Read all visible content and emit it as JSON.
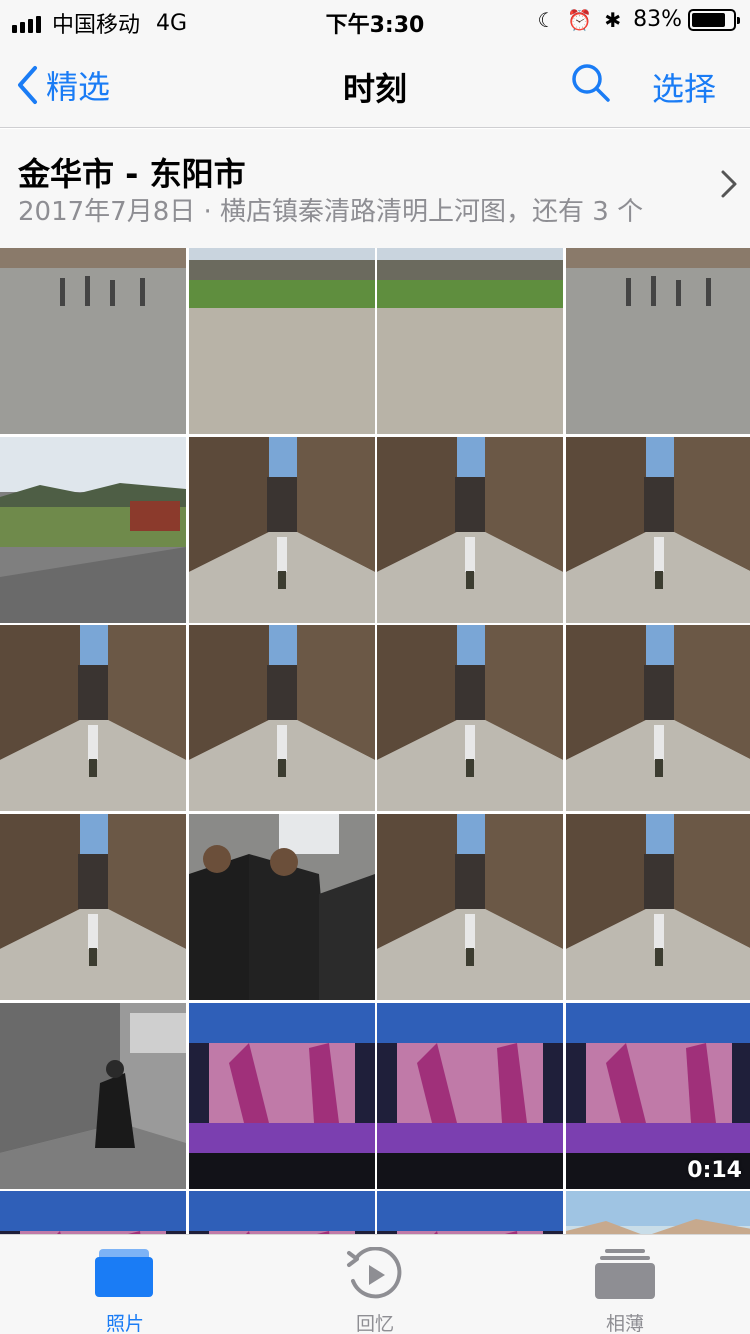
{
  "status_bar": {
    "carrier": "中国移动",
    "network": "4G",
    "time": "下午3:30",
    "battery_percent": "83%",
    "battery_level": 0.83,
    "icons": [
      "moon-icon",
      "alarm-icon",
      "bluetooth-icon"
    ]
  },
  "nav": {
    "back_label": "精选",
    "title": "时刻",
    "select_label": "选择"
  },
  "moment": {
    "title": "金华市 - 东阳市",
    "subtitle": "2017年7月8日 · 横店镇秦清路清明上河图，还有 3 个"
  },
  "photos": [
    {
      "kind": "plaza"
    },
    {
      "kind": "lawn"
    },
    {
      "kind": "lawn"
    },
    {
      "kind": "plaza"
    },
    {
      "kind": "city"
    },
    {
      "kind": "corridor"
    },
    {
      "kind": "corridor"
    },
    {
      "kind": "corridor"
    },
    {
      "kind": "corridor"
    },
    {
      "kind": "corridor"
    },
    {
      "kind": "corridor"
    },
    {
      "kind": "corridor"
    },
    {
      "kind": "corridor"
    },
    {
      "kind": "actors"
    },
    {
      "kind": "corridor"
    },
    {
      "kind": "corridor"
    },
    {
      "kind": "bw"
    },
    {
      "kind": "stage"
    },
    {
      "kind": "stage"
    },
    {
      "kind": "stage",
      "duration": "0:14"
    },
    {
      "kind": "stage"
    },
    {
      "kind": "stage"
    },
    {
      "kind": "stage"
    },
    {
      "kind": "beach"
    }
  ],
  "tabs": [
    {
      "label": "照片",
      "icon": "photos-icon",
      "active": true
    },
    {
      "label": "回忆",
      "icon": "memories-icon",
      "active": false
    },
    {
      "label": "相薄",
      "icon": "albums-icon",
      "active": false
    }
  ],
  "colors": {
    "accent": "#1a7cf5",
    "bar_background": "#f7f7f7",
    "secondary_text": "#8e8e93"
  }
}
